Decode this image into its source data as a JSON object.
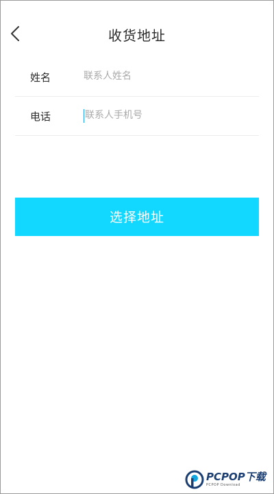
{
  "header": {
    "back_icon": "chevron-left-icon",
    "title": "收货地址"
  },
  "form": {
    "name": {
      "label": "姓名",
      "placeholder": "联系人姓名",
      "value": ""
    },
    "phone": {
      "label": "电话",
      "placeholder": "联系人手机号",
      "value": ""
    }
  },
  "actions": {
    "select_address_label": "选择地址"
  },
  "watermark": {
    "brand": "PCPOP下载",
    "subtitle": "PCPOP Download"
  },
  "colors": {
    "accent": "#12d7ff",
    "cursor": "#1aa1e8",
    "watermark_blue": "#1a3e72"
  }
}
